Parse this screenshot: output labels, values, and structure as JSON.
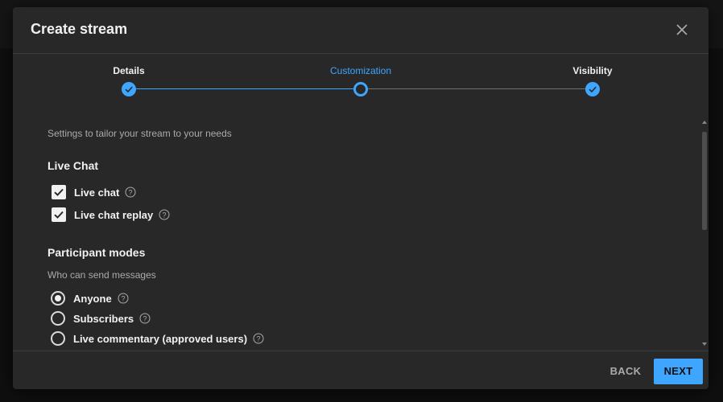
{
  "dialog": {
    "title": "Create stream"
  },
  "stepper": {
    "steps": [
      {
        "label": "Details",
        "state": "done"
      },
      {
        "label": "Customization",
        "state": "current"
      },
      {
        "label": "Visibility",
        "state": "done"
      }
    ]
  },
  "content": {
    "intro": "Settings to tailor your stream to your needs",
    "live_chat": {
      "title": "Live Chat",
      "options": [
        {
          "label": "Live chat",
          "checked": true
        },
        {
          "label": "Live chat replay",
          "checked": true
        }
      ]
    },
    "participant_modes": {
      "title": "Participant modes",
      "subtitle": "Who can send messages",
      "options": [
        {
          "label": "Anyone",
          "selected": true
        },
        {
          "label": "Subscribers",
          "selected": false
        },
        {
          "label": "Live commentary (approved users)",
          "selected": false
        }
      ]
    }
  },
  "footer": {
    "back_label": "BACK",
    "next_label": "NEXT"
  },
  "icons": {
    "close": "close-icon",
    "help": "help-circle-icon",
    "check": "check-icon"
  },
  "colors": {
    "accent": "#3ea6ff",
    "dialog_bg": "#282828",
    "text": "#f1f1f1",
    "muted": "#aaaaaa"
  }
}
